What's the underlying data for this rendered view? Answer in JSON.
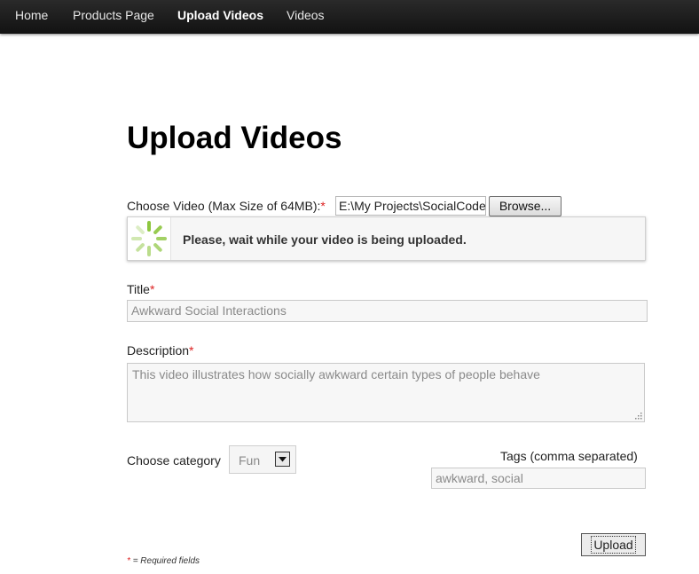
{
  "nav": {
    "items": [
      {
        "label": "Home"
      },
      {
        "label": "Products Page"
      },
      {
        "label": "Upload Videos"
      },
      {
        "label": "Videos"
      }
    ]
  },
  "page": {
    "title": "Upload Videos"
  },
  "form": {
    "video_label": "Choose Video (Max Size of 64MB):",
    "required_mark": "*",
    "video_path": "E:\\My Projects\\SocialCoder",
    "browse_label": "Browse...",
    "upload_status": "Please, wait while your video is being uploaded.",
    "title_label": "Title",
    "title_value": "Awkward Social Interactions",
    "description_label": "Description",
    "description_value": "This video illustrates how socially awkward certain types of people behave",
    "category_label": "Choose category",
    "category_value": "Fun",
    "tags_label": "Tags (comma separated)",
    "tags_value": "awkward, social",
    "upload_label": "Upload",
    "required_note": "= Required fields"
  },
  "colors": {
    "nav_bg": "#1a1a1a",
    "required": "#dd2222",
    "spinner_green": "#8dc63f"
  },
  "icons": {
    "spinner": "loading-spinner-icon",
    "select_arrow": "chevron-down-icon",
    "resize": "resize-grip-icon"
  }
}
